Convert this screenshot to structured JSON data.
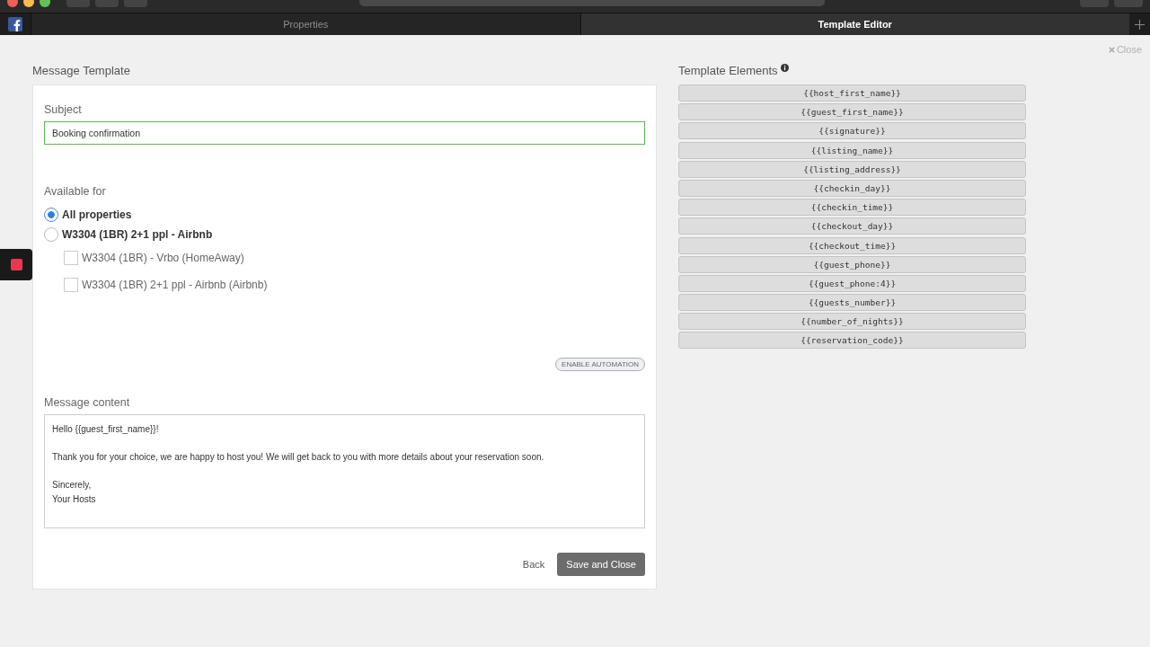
{
  "browser_tabs": [
    {
      "label": "Properties",
      "selected": false
    },
    {
      "label": "Template Editor",
      "selected": true
    }
  ],
  "close": "Close",
  "message_template": {
    "title": "Message Template",
    "subject_label": "Subject",
    "subject_value": "Booking confirmation",
    "available_label": "Available for",
    "options": [
      {
        "label": "All properties",
        "selected": true
      },
      {
        "label": "W3304 (1BR) 2+1 ppl - Airbnb",
        "selected": false
      }
    ],
    "sub_options": [
      {
        "label": "W3304 (1BR) - Vrbo (HomeAway)",
        "checked": false
      },
      {
        "label": "W3304 (1BR) 2+1 ppl - Airbnb (Airbnb)",
        "checked": false
      }
    ],
    "automation_button": "ENABLE AUTOMATION",
    "content_label": "Message content",
    "content_paragraphs": [
      "Hello {{guest_first_name}}!",
      "Thank you for your choice, we are happy to host you! We will get back to you with more details about your reservation soon.",
      "Sincerely,\nYour Hosts"
    ],
    "back": "Back",
    "save": "Save and Close"
  },
  "template_elements": {
    "title": "Template Elements",
    "items": [
      "{{host_first_name}}",
      "{{guest_first_name}}",
      "{{signature}}",
      "{{listing_name}}",
      "{{listing_address}}",
      "{{checkin_day}}",
      "{{checkin_time}}",
      "{{checkout_day}}",
      "{{checkout_time}}",
      "{{guest_phone}}",
      "{{guest_phone:4}}",
      "{{guests_number}}",
      "{{number_of_nights}}",
      "{{reservation_code}}"
    ]
  }
}
